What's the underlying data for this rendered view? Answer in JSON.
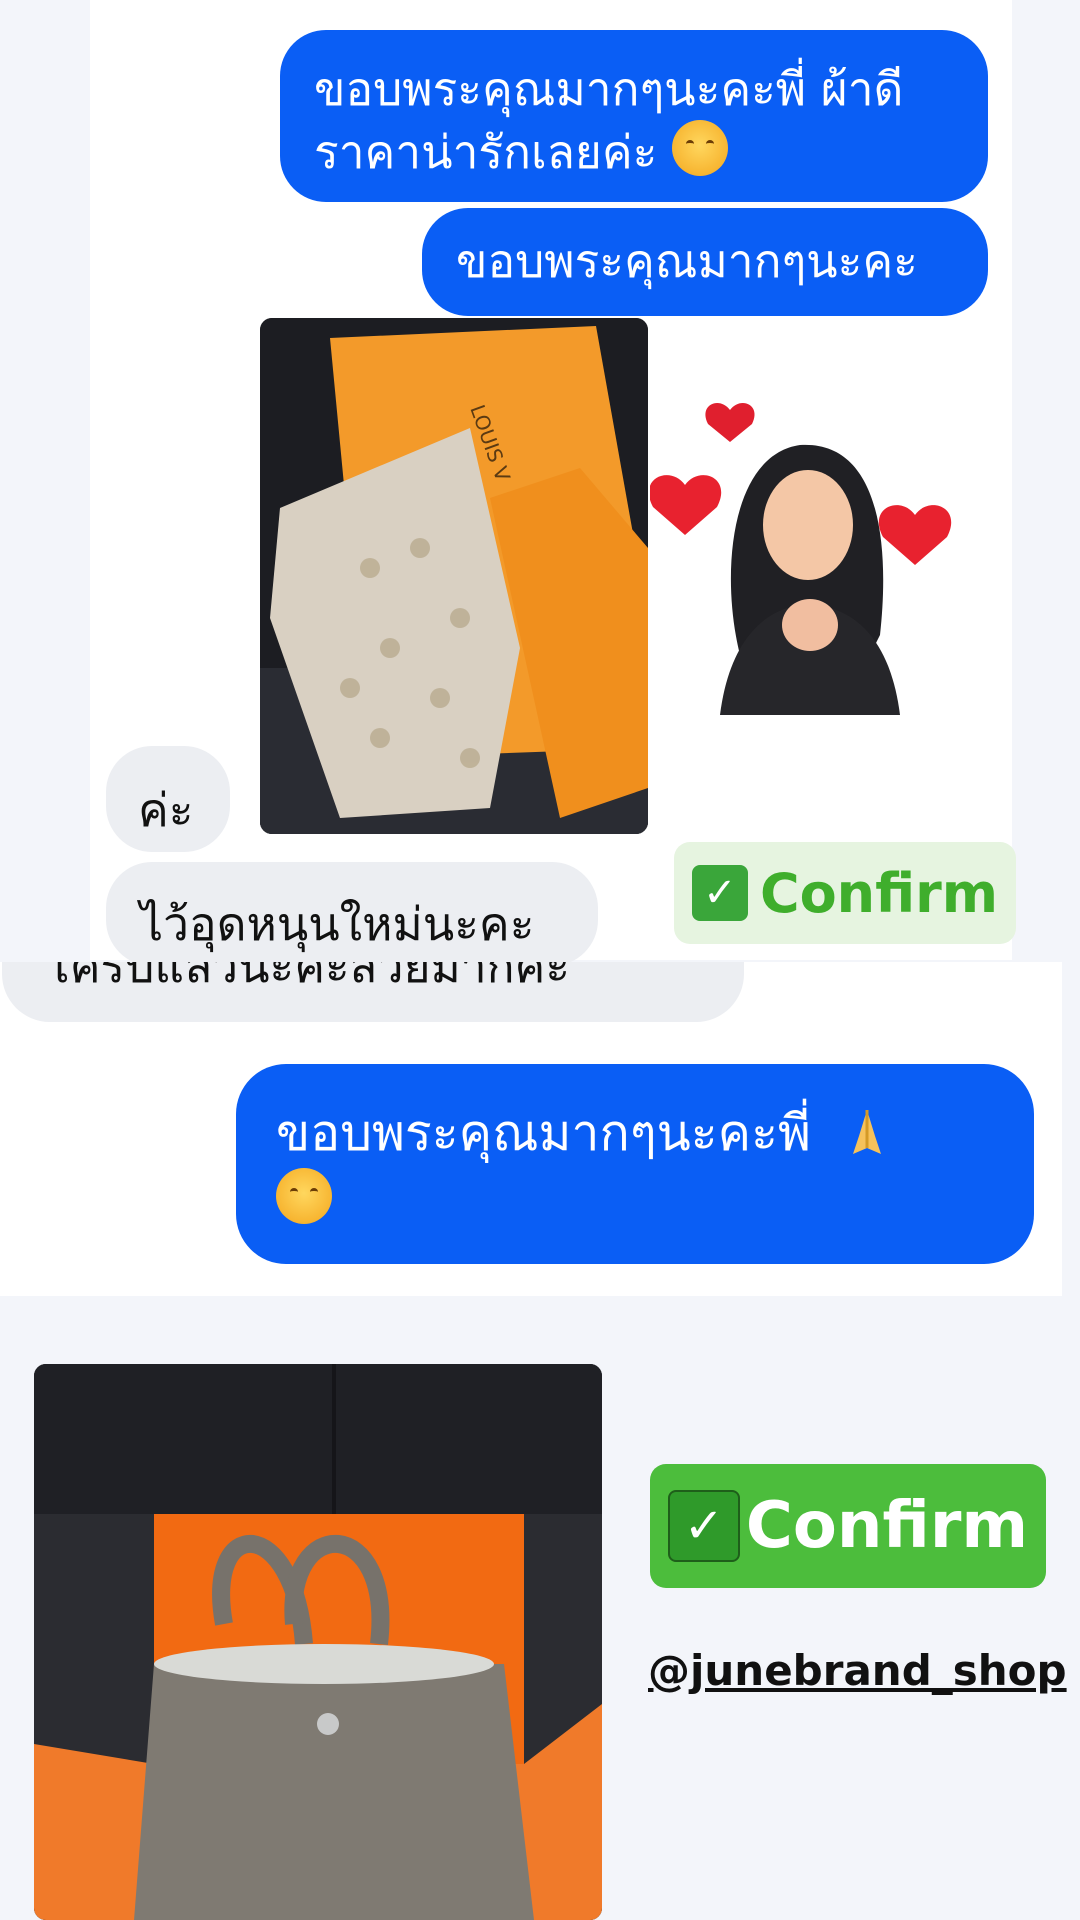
{
  "messages": {
    "m1_line1": "ขอบพระคุณมากๆนะคะพี่ ผ้าดี",
    "m1_line2": "ราคาน่ารักเลยค่ะ",
    "m2": "ขอบพระคุณมากๆนะคะ",
    "m3": "ค่ะ",
    "m4": "ไว้อุดหนุนใหม่นะคะ",
    "m5_partial": "เคริบแล้วนะคะสวยมากค่ะ",
    "m6": "ขอบพระคุณมากๆนะคะพี่"
  },
  "photos": {
    "scarf_box_text": "LOUIS V"
  },
  "confirm1": {
    "check": "✓",
    "label": "Confirm"
  },
  "confirm2": {
    "check": "✓",
    "label": "Confirm"
  },
  "handle": "@junebrand_shop",
  "colors": {
    "blue_bubble": "#0a5ef5",
    "gray_bubble": "#eceef2",
    "confirm_light_bg": "#e6f4e0",
    "confirm_light_text": "#3fae2c",
    "confirm_dark_bg": "#4cbd3c"
  }
}
